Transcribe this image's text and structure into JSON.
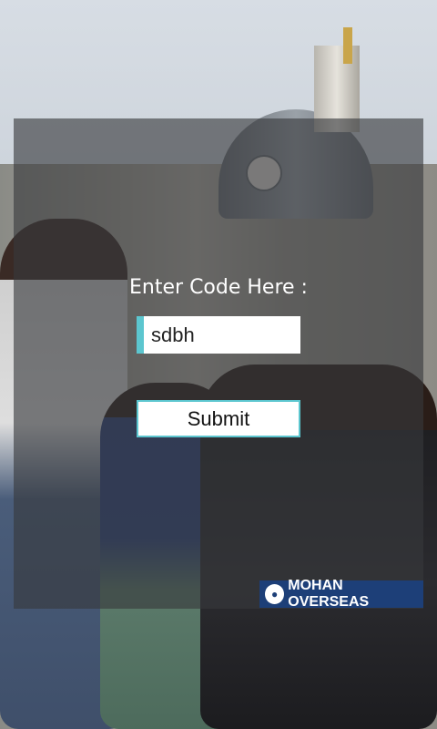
{
  "form": {
    "prompt": "Enter Code Here :",
    "code_value": "sdbh",
    "submit_label": "Submit"
  },
  "branding": {
    "logo_text": "MOHAN OVERSEAS"
  },
  "colors": {
    "accent": "#5cc6cf",
    "logo_bg": "#1d3f78",
    "overlay": "rgba(55,57,60,0.62)"
  }
}
